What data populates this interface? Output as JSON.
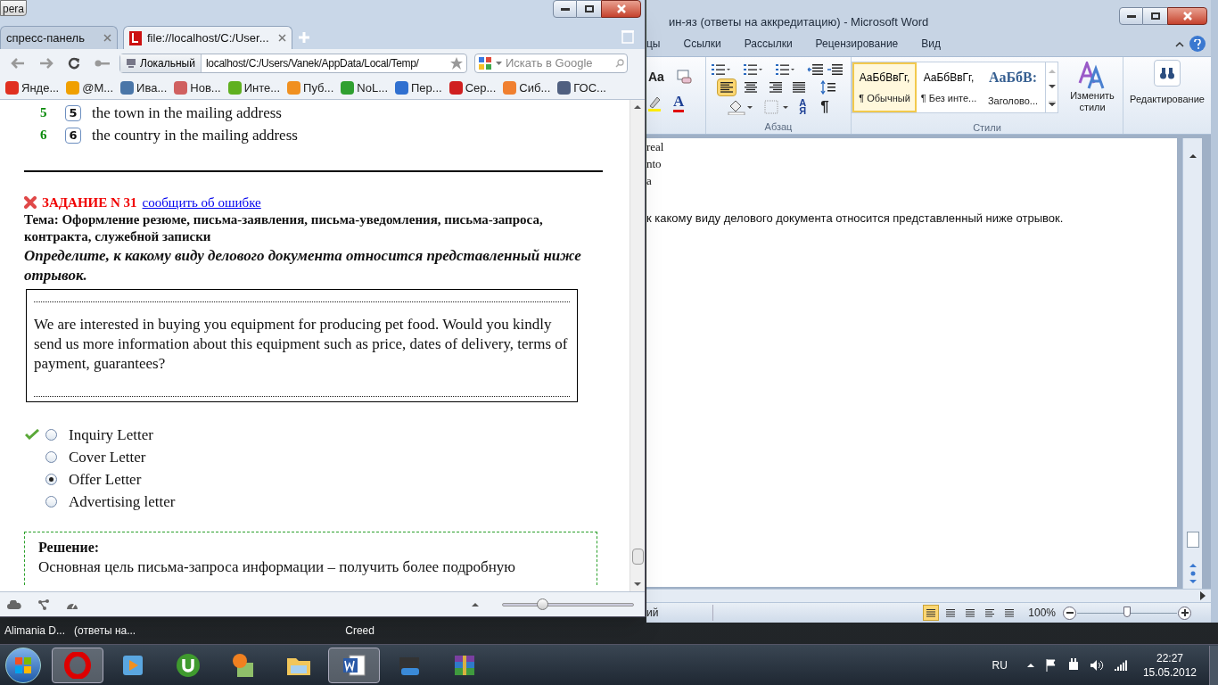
{
  "word": {
    "title": "ин-яз (ответы на аккредитацию)  -  Microsoft Word",
    "ribbon_tabs": [
      {
        "label": "цы",
        "selected": false
      },
      {
        "label": "Ссылки",
        "selected": false
      },
      {
        "label": "Рассылки",
        "selected": false
      },
      {
        "label": "Рецензирование",
        "selected": false
      },
      {
        "label": "Вид",
        "selected": false
      }
    ],
    "font_group": {
      "case_button": "Aa",
      "font_color_button": "A"
    },
    "paragraph_group": {
      "label": "Абзац",
      "align": [
        {
          "kind": "left",
          "selected": true
        },
        {
          "kind": "center",
          "selected": false
        },
        {
          "kind": "right",
          "selected": false
        },
        {
          "kind": "justify",
          "selected": false
        }
      ],
      "sort_button": "АЯ",
      "pilcrow_button": "¶"
    },
    "styles_group": {
      "label": "Стили",
      "styles": [
        {
          "sample": "АаБбВвГг,",
          "name": "¶ Обычный",
          "kind": "normal",
          "selected": true
        },
        {
          "sample": "АаБбВвГг,",
          "name": "¶ Без инте...",
          "kind": "normal",
          "selected": false
        },
        {
          "sample": "АаБбВ:",
          "name": "Заголово...",
          "kind": "heading",
          "selected": false
        }
      ],
      "change_styles": "Изменить стили"
    },
    "editing_button": "Редактирование",
    "document_lines": [
      "real",
      "nto",
      "a",
      "к какому виду делового документа относится представленный ниже отрывок."
    ],
    "status_bar": {
      "page_info": "ий",
      "views": [
        {
          "kind": "print",
          "selected": true
        },
        {
          "kind": "reading",
          "selected": false
        },
        {
          "kind": "web",
          "selected": false
        },
        {
          "kind": "outline",
          "selected": false
        },
        {
          "kind": "draft",
          "selected": false
        }
      ],
      "zoom": "100%",
      "zoom_slider": {
        "level": 0.5
      }
    }
  },
  "opera": {
    "menu_button": "pera",
    "tabs": [
      {
        "label": "спресс-панель",
        "selected": false
      },
      {
        "label": "file://localhost/C:/User...",
        "selected": true
      }
    ],
    "address": {
      "badge": "Локальный",
      "value": "localhost/C:/Users/Vanek/AppData/Local/Temp/"
    },
    "search": {
      "placeholder": "Искать в Google"
    },
    "bookmarks": [
      {
        "label": "Янде...",
        "color": "#e03020"
      },
      {
        "label": "@M...",
        "color": "#f0a000"
      },
      {
        "label": "Ива...",
        "color": "#4a76a8"
      },
      {
        "label": "Нов...",
        "color": "#d06060"
      },
      {
        "label": "Инте...",
        "color": "#60b020"
      },
      {
        "label": "Пуб...",
        "color": "#f09020"
      },
      {
        "label": "NoL...",
        "color": "#30a030"
      },
      {
        "label": "Пер...",
        "color": "#3070d0"
      },
      {
        "label": "Сер...",
        "color": "#d02020"
      },
      {
        "label": "Сиб...",
        "color": "#f08030"
      },
      {
        "label": "ГОС...",
        "color": "#506080"
      }
    ],
    "page": {
      "matches": [
        {
          "number": "5",
          "key": "5",
          "text": "the town in the mailing address"
        },
        {
          "number": "6",
          "key": "6",
          "text": "the country in the mailing address"
        }
      ],
      "task": {
        "title": "ЗАДАНИЕ N 31",
        "report_link": "сообщить об ошибке",
        "topic": "Тема: Оформление резюме, письма-заявления, письма-уведомления, письма-запроса, контракта, служебной записки",
        "question": "Определите, к какому виду делового документа относится представленный ниже отрывок.",
        "passage": "We are interested in buying you equipment for producing pet food. Would you kindly send us more information about this equipment such as price, dates of delivery, terms of payment, guarantees?",
        "options": [
          {
            "label": "Inquiry Letter",
            "selected": false,
            "correct": true
          },
          {
            "label": "Cover Letter",
            "selected": false,
            "correct": false
          },
          {
            "label": "Offer Letter",
            "selected": true,
            "correct": false
          },
          {
            "label": "Advertising letter",
            "selected": false,
            "correct": false
          }
        ],
        "solution_title": "Решение:",
        "solution_text": "Основная цель письма-запроса информации – получить более подробную"
      }
    },
    "zoom_slider": {
      "level": 0.3
    }
  },
  "desktop_labels": [
    "Alimania D...",
    "(ответы на...",
    "Creed"
  ],
  "taskbar": {
    "apps": [
      {
        "kind": "opera",
        "selected": true
      },
      {
        "kind": "player",
        "selected": false
      },
      {
        "kind": "torrent",
        "selected": false
      },
      {
        "kind": "map",
        "selected": false
      },
      {
        "kind": "folder",
        "selected": false
      },
      {
        "kind": "word",
        "selected": true
      },
      {
        "kind": "video",
        "selected": false
      },
      {
        "kind": "archive",
        "selected": false
      }
    ],
    "language": "RU",
    "time": "22:27",
    "date": "15.05.2012"
  }
}
